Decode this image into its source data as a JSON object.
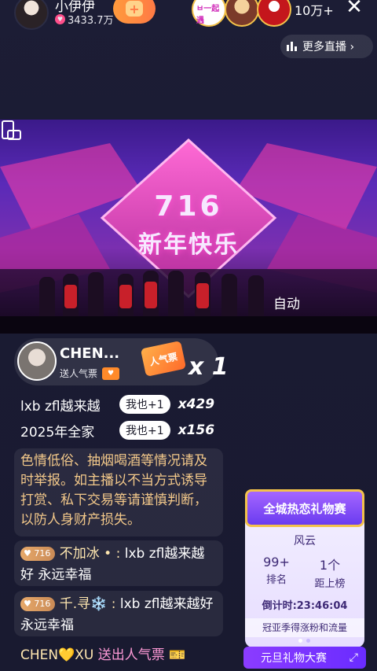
{
  "host": {
    "name": "小伊伊",
    "likes": "3433.7万"
  },
  "viewers": {
    "logo_text": "ㅂ一起遇",
    "count": "10万+"
  },
  "more_live": "更多直播 ›",
  "video": {
    "banner_number": "716",
    "banner_title": "新年快乐",
    "auto_label": "自动"
  },
  "gift": {
    "user": "CHEN...",
    "action": "送人气票",
    "ticket_label": "人气票",
    "count": "x 1"
  },
  "me_too": [
    {
      "text": "lxb zfl越来越",
      "button": "我也+1",
      "count": "x429"
    },
    {
      "text": "2025年全家",
      "button": "我也+1",
      "count": "x156"
    }
  ],
  "notice": "色情低俗、抽烟喝酒等情况请及时举报。如主播以不当方式诱导打赏、私下交易等请谨慎判断，以防人身财产损失。",
  "chats": [
    {
      "level": "716",
      "nick": "不加冰 • :",
      "message": "lxb zfl越来越好 永远幸福"
    },
    {
      "level": "716",
      "nick": "千.寻❄️ :",
      "message": "lxb zfl越来越好 永远幸福"
    }
  ],
  "last_line": {
    "who": "CHEN💛XU",
    "action": "送出人气票"
  },
  "activity": {
    "title": "全城热恋礼物赛",
    "name": "风云",
    "rank_value": "99+",
    "rank_label": "排名",
    "gap_value": "1个",
    "gap_label": "距上榜",
    "timer": "倒计时:23:46:04",
    "footer": "冠亚季得涨粉和流量",
    "button": "元旦礼物大赛"
  }
}
